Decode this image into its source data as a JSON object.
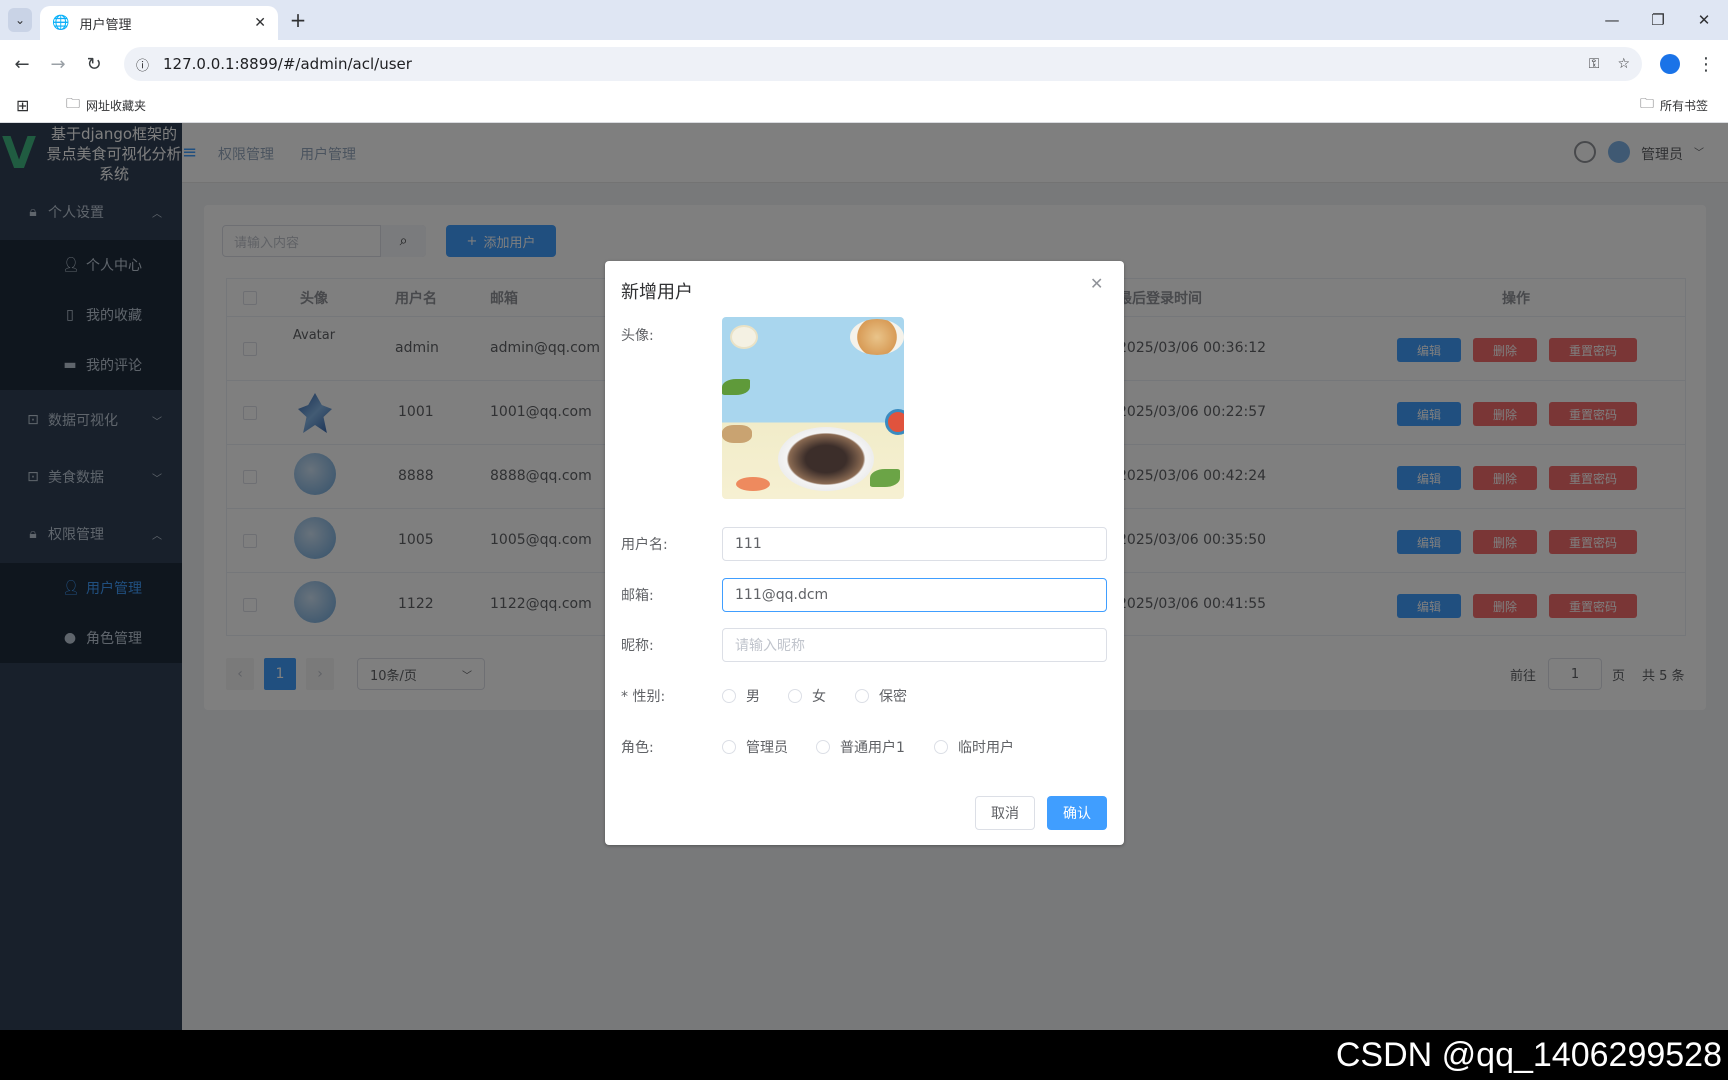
{
  "browser": {
    "tab_title": "用户管理",
    "url": "127.0.0.1:8899/#/admin/acl/user",
    "bookmark_folder": "网址收藏夹",
    "all_bookmarks": "所有书签"
  },
  "app": {
    "logo_text": "基于django框架的景点美食可视化分析系统",
    "breadcrumb": [
      "权限管理",
      "用户管理"
    ],
    "user_name": "管理员"
  },
  "sidebar": {
    "items": [
      {
        "label": "个人设置",
        "icon": "lock-icon"
      },
      {
        "label": "个人中心",
        "icon": "user-icon"
      },
      {
        "label": "我的收藏",
        "icon": "bookmark-icon"
      },
      {
        "label": "我的评论",
        "icon": "comment-icon"
      },
      {
        "label": "数据可视化",
        "icon": "chart-icon"
      },
      {
        "label": "美食数据",
        "icon": "chart-icon"
      },
      {
        "label": "权限管理",
        "icon": "lock-icon"
      },
      {
        "label": "用户管理",
        "icon": "user-icon"
      },
      {
        "label": "角色管理",
        "icon": "person-icon"
      }
    ]
  },
  "toolbar": {
    "search_placeholder": "请输入内容",
    "add_label": "添加用户"
  },
  "table": {
    "headers": [
      "头像",
      "用户名",
      "邮箱",
      "最后登录时间",
      "操作"
    ],
    "rows": [
      {
        "avatar_alt": "Avatar",
        "username": "admin",
        "email": "admin@qq.com",
        "last_login": "2025/03/06 00:36:12"
      },
      {
        "username": "1001",
        "email": "1001@qq.com",
        "last_login": "2025/03/06 00:22:57"
      },
      {
        "username": "8888",
        "email": "8888@qq.com",
        "last_login": "2025/03/06 00:42:24"
      },
      {
        "username": "1005",
        "email": "1005@qq.com",
        "last_login": "2025/03/06 00:35:50"
      },
      {
        "username": "1122",
        "email": "1122@qq.com",
        "last_login": "2025/03/06 00:41:55"
      }
    ],
    "edit_label": "编辑",
    "delete_label": "删除",
    "reset_label": "重置密码"
  },
  "pagination": {
    "current_page": "1",
    "page_size": "10条/页",
    "goto_label": "前往",
    "goto_value": "1",
    "page_unit": "页",
    "total": "共 5 条"
  },
  "dialog": {
    "title": "新增用户",
    "avatar_label": "头像:",
    "username_label": "用户名:",
    "username_value": "111",
    "email_label": "邮箱:",
    "email_value": "111@qq.dcm",
    "nickname_label": "昵称:",
    "nickname_placeholder": "请输入昵称",
    "gender_label": "* 性别:",
    "gender_options": [
      "男",
      "女",
      "保密"
    ],
    "role_label": "角色:",
    "role_options": [
      "管理员",
      "普通用户1",
      "临时用户"
    ],
    "cancel_label": "取消",
    "confirm_label": "确认"
  },
  "watermark": "CSDN @qq_1406299528",
  "colors": {
    "primary": "#409eff",
    "danger": "#f56c6c",
    "sidebar": "#304156"
  }
}
